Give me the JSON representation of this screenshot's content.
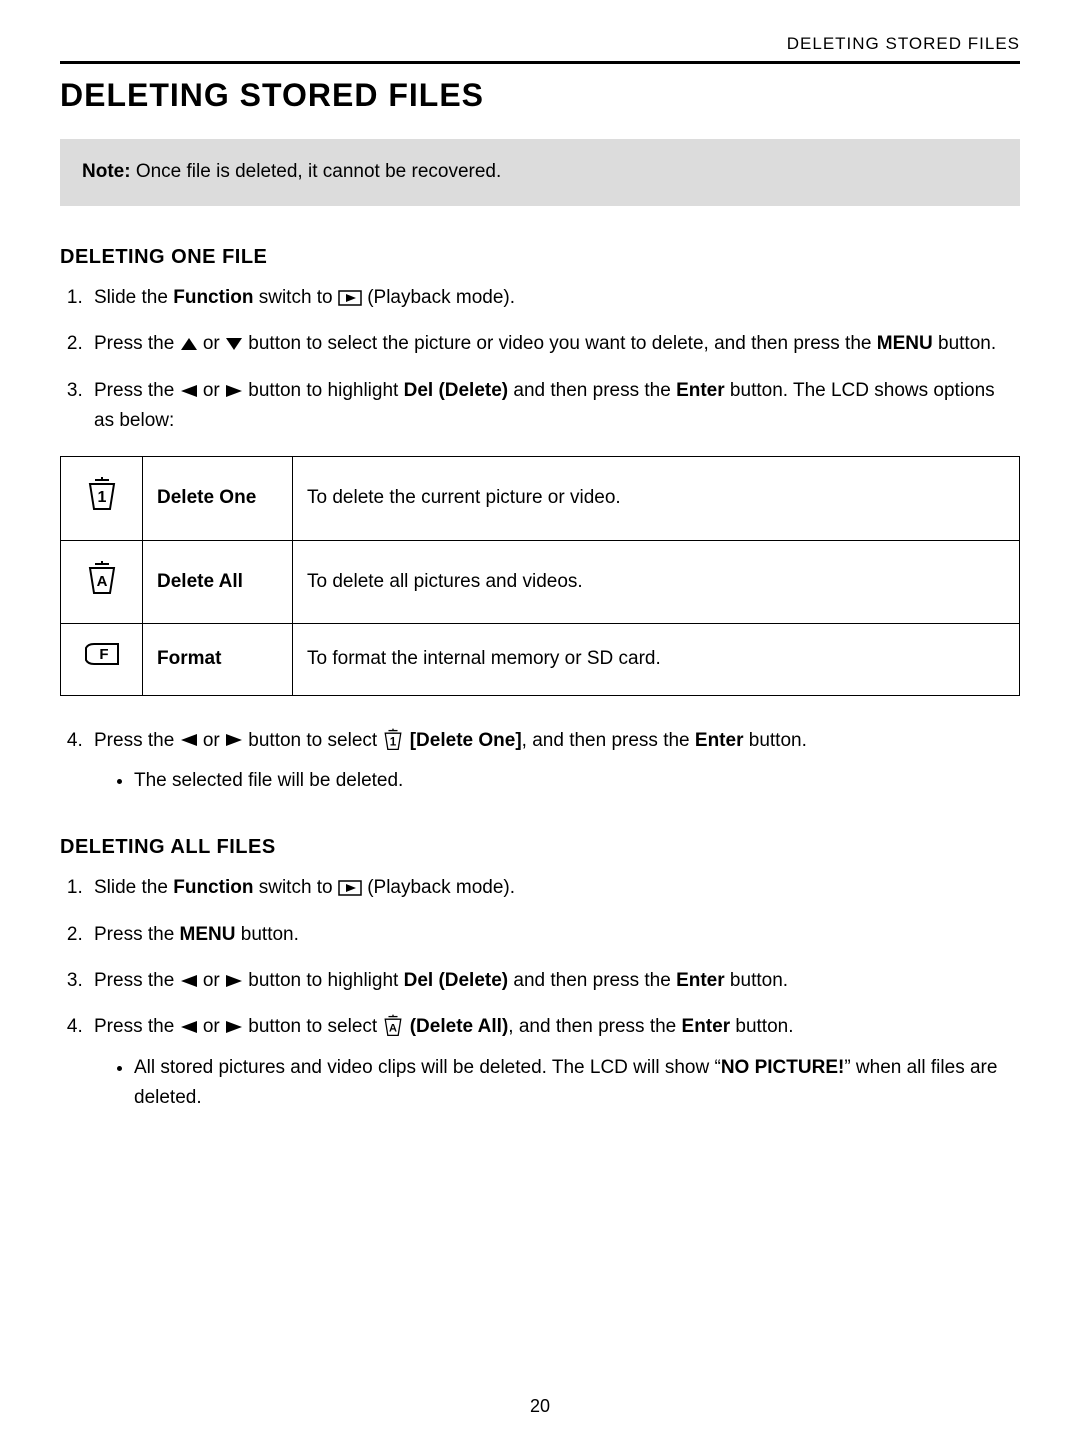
{
  "header_label": "DELETING STORED FILES",
  "main_title": "DELETING STORED FILES",
  "note_label": "Note:",
  "note_text": " Once file is deleted, it cannot be recovered.",
  "section1": {
    "title": "DELETING ONE FILE",
    "step1_a": "Slide the ",
    "step1_b": "Function",
    "step1_c": " switch to ",
    "step1_d": " (Playback mode).",
    "step2_a": "Press the ",
    "step2_b": " or ",
    "step2_c": " button to select the picture or video you want to delete, and then press the ",
    "step2_d": "MENU",
    "step2_e": " button.",
    "step3_a": "Press the ",
    "step3_b": " or ",
    "step3_c": " button to highlight ",
    "step3_d": "Del (Delete)",
    "step3_e": " and then press the ",
    "step3_f": "Enter",
    "step3_g": " button. The LCD shows options as below:",
    "step4_a": "Press the ",
    "step4_b": " or ",
    "step4_c": " button to select ",
    "step4_d": " [Delete One]",
    "step4_e": ", and then press the ",
    "step4_f": "Enter",
    "step4_g": " button.",
    "step4_bullet": "The selected file will be deleted."
  },
  "options_table": [
    {
      "name": "Delete One",
      "desc": "To delete the current picture or video."
    },
    {
      "name": "Delete All",
      "desc": "To delete all pictures and videos."
    },
    {
      "name": "Format",
      "desc": "To format the internal memory or SD card."
    }
  ],
  "section2": {
    "title": "DELETING ALL FILES",
    "step1_a": "Slide the ",
    "step1_b": "Function",
    "step1_c": " switch to ",
    "step1_d": " (Playback mode).",
    "step2_a": "Press the ",
    "step2_b": "MENU",
    "step2_c": " button.",
    "step3_a": "Press the ",
    "step3_b": " or ",
    "step3_c": " button to highlight ",
    "step3_d": "Del (Delete)",
    "step3_e": " and then press the ",
    "step3_f": "Enter",
    "step3_g": " button.",
    "step4_a": "Press the ",
    "step4_b": " or ",
    "step4_c": " button to select ",
    "step4_d": " (Delete All)",
    "step4_e": ", and then press the ",
    "step4_f": "Enter",
    "step4_g": " button.",
    "step4_bullet_a": "All stored pictures and video clips will be deleted. The LCD will show “",
    "step4_bullet_b": "NO PICTURE!",
    "step4_bullet_c": "” when all files are deleted."
  },
  "page_number": "20"
}
